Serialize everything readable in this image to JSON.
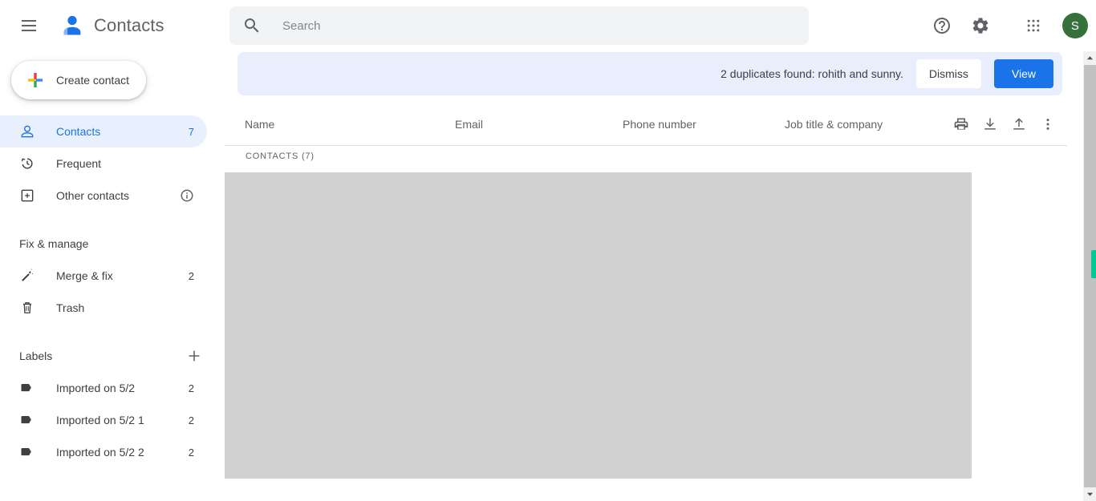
{
  "app": {
    "title": "Contacts",
    "menu_icon": "hamburger-icon",
    "logo_icon": "contacts-logo-icon"
  },
  "search": {
    "placeholder": "Search",
    "value": "",
    "icon": "search-icon"
  },
  "topbar_actions": [
    {
      "name": "help-icon",
      "label": "Support"
    },
    {
      "name": "gear-icon",
      "label": "Settings"
    },
    {
      "name": "apps-grid-icon",
      "label": "Google apps"
    }
  ],
  "account": {
    "avatar_initial": "S",
    "avatar_color": "#36703b"
  },
  "sidebar": {
    "create_button": {
      "label": "Create contact",
      "icon": "google-plus-icon"
    },
    "nav_items": [
      {
        "label": "Contacts",
        "count": "7",
        "icon": "person-icon",
        "selected": true
      },
      {
        "label": "Frequent",
        "count": "",
        "icon": "history-icon",
        "selected": false
      },
      {
        "label": "Other contacts",
        "count": "",
        "icon": "other-contacts-icon",
        "selected": false,
        "info": true
      }
    ],
    "fix_manage": {
      "title": "Fix & manage",
      "items": [
        {
          "label": "Merge & fix",
          "count": "2",
          "icon": "magic-wand-icon"
        },
        {
          "label": "Trash",
          "count": "",
          "icon": "trash-icon"
        }
      ]
    },
    "labels": {
      "title": "Labels",
      "add_icon": "plus-icon",
      "items": [
        {
          "label": "Imported on 5/2",
          "count": "2",
          "icon": "label-tag-icon"
        },
        {
          "label": "Imported on 5/2 1",
          "count": "2",
          "icon": "label-tag-icon"
        },
        {
          "label": "Imported on 5/2 2",
          "count": "2",
          "icon": "label-tag-icon"
        }
      ]
    }
  },
  "banner": {
    "message": "2 duplicates found: rohith and sunny.",
    "dismiss_label": "Dismiss",
    "view_label": "View",
    "background": "#e8eefc",
    "view_color": "#1a73e8"
  },
  "table": {
    "columns": [
      "Name",
      "Email",
      "Phone number",
      "Job title & company"
    ],
    "section_label": "CONTACTS (7)",
    "actions": [
      {
        "name": "print-icon",
        "label": "Print"
      },
      {
        "name": "download-icon",
        "label": "Export"
      },
      {
        "name": "upload-icon",
        "label": "Import"
      },
      {
        "name": "more-vert-icon",
        "label": "More options"
      }
    ]
  },
  "scrollbar": {
    "thumb_color": "#00c993",
    "up_icon": "triangle-up-icon",
    "down_icon": "triangle-down-icon"
  }
}
